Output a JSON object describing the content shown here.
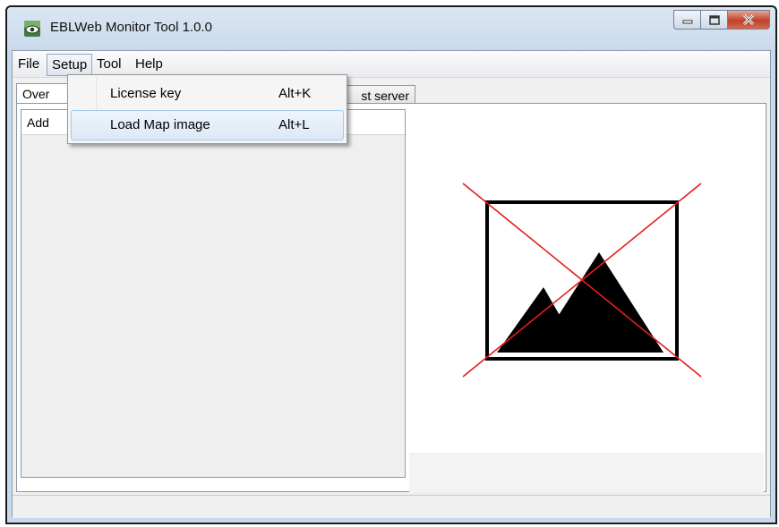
{
  "window": {
    "title": "EBLWeb Monitor Tool 1.0.0"
  },
  "menubar": {
    "items": [
      "File",
      "Setup",
      "Tool",
      "Help"
    ]
  },
  "setup_menu": {
    "items": [
      {
        "label": "License key",
        "shortcut": "Alt+K"
      },
      {
        "label": "Load Map image",
        "shortcut": "Alt+L"
      }
    ]
  },
  "tabs": {
    "first": "Over",
    "second": "st server"
  },
  "list": {
    "header": "Add"
  },
  "map": {
    "icon": "broken-image-icon"
  },
  "colors": {
    "accent": "#e81c1c",
    "title_bg": "#c9d9ec"
  }
}
